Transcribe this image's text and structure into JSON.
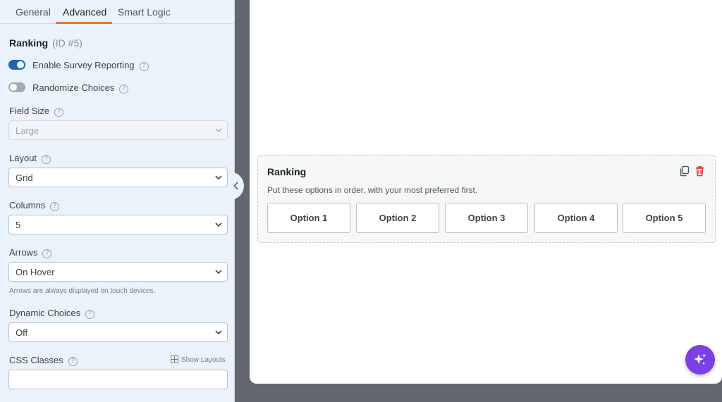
{
  "tabs": [
    {
      "label": "General",
      "active": false
    },
    {
      "label": "Advanced",
      "active": true
    },
    {
      "label": "Smart Logic",
      "active": false
    }
  ],
  "field": {
    "title": "Ranking",
    "id_label": "(ID #5)"
  },
  "toggles": {
    "survey": {
      "label": "Enable Survey Reporting",
      "on": true
    },
    "randomize": {
      "label": "Randomize Choices",
      "on": false
    }
  },
  "help_glyph": "?",
  "field_size": {
    "label": "Field Size",
    "value": "Large"
  },
  "layout": {
    "label": "Layout",
    "value": "Grid"
  },
  "columns": {
    "label": "Columns",
    "value": "5"
  },
  "arrows": {
    "label": "Arrows",
    "value": "On Hover",
    "help_text": "Arrows are always displayed on touch devices."
  },
  "dynamic_choices": {
    "label": "Dynamic Choices",
    "value": "Off"
  },
  "css_classes": {
    "label": "CSS Classes",
    "show_layouts": "Show Layouts",
    "value": ""
  },
  "preview": {
    "title": "Ranking",
    "description": "Put these options in order, with your most preferred first.",
    "options": [
      "Option 1",
      "Option 2",
      "Option 3",
      "Option 4",
      "Option 5"
    ]
  },
  "colors": {
    "accent": "#e27730",
    "toggle_on": "#1d67a8",
    "ai_button": "#7b3fe4",
    "delete": "#d63638"
  }
}
